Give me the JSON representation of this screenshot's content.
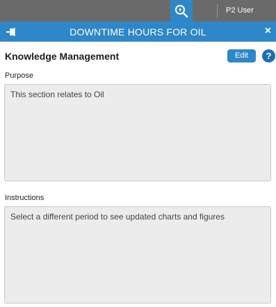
{
  "topbar": {
    "search_icon": "search-lightning-icon",
    "user": "P2 User"
  },
  "header": {
    "title": "DOWNTIME HOURS FOR OIL",
    "pin_icon": "pin-icon",
    "close_label": "×"
  },
  "knowledge": {
    "title": "Knowledge Management",
    "edit_label": "Edit",
    "help_label": "?"
  },
  "purpose": {
    "label": "Purpose",
    "text": "This section relates to Oil"
  },
  "instructions": {
    "label": "Instructions",
    "text": "Select a different period to see updated charts and figures"
  },
  "colors": {
    "accent": "#2e87c8",
    "topbar": "#6a6a6a",
    "textarea_bg": "#ececec"
  }
}
